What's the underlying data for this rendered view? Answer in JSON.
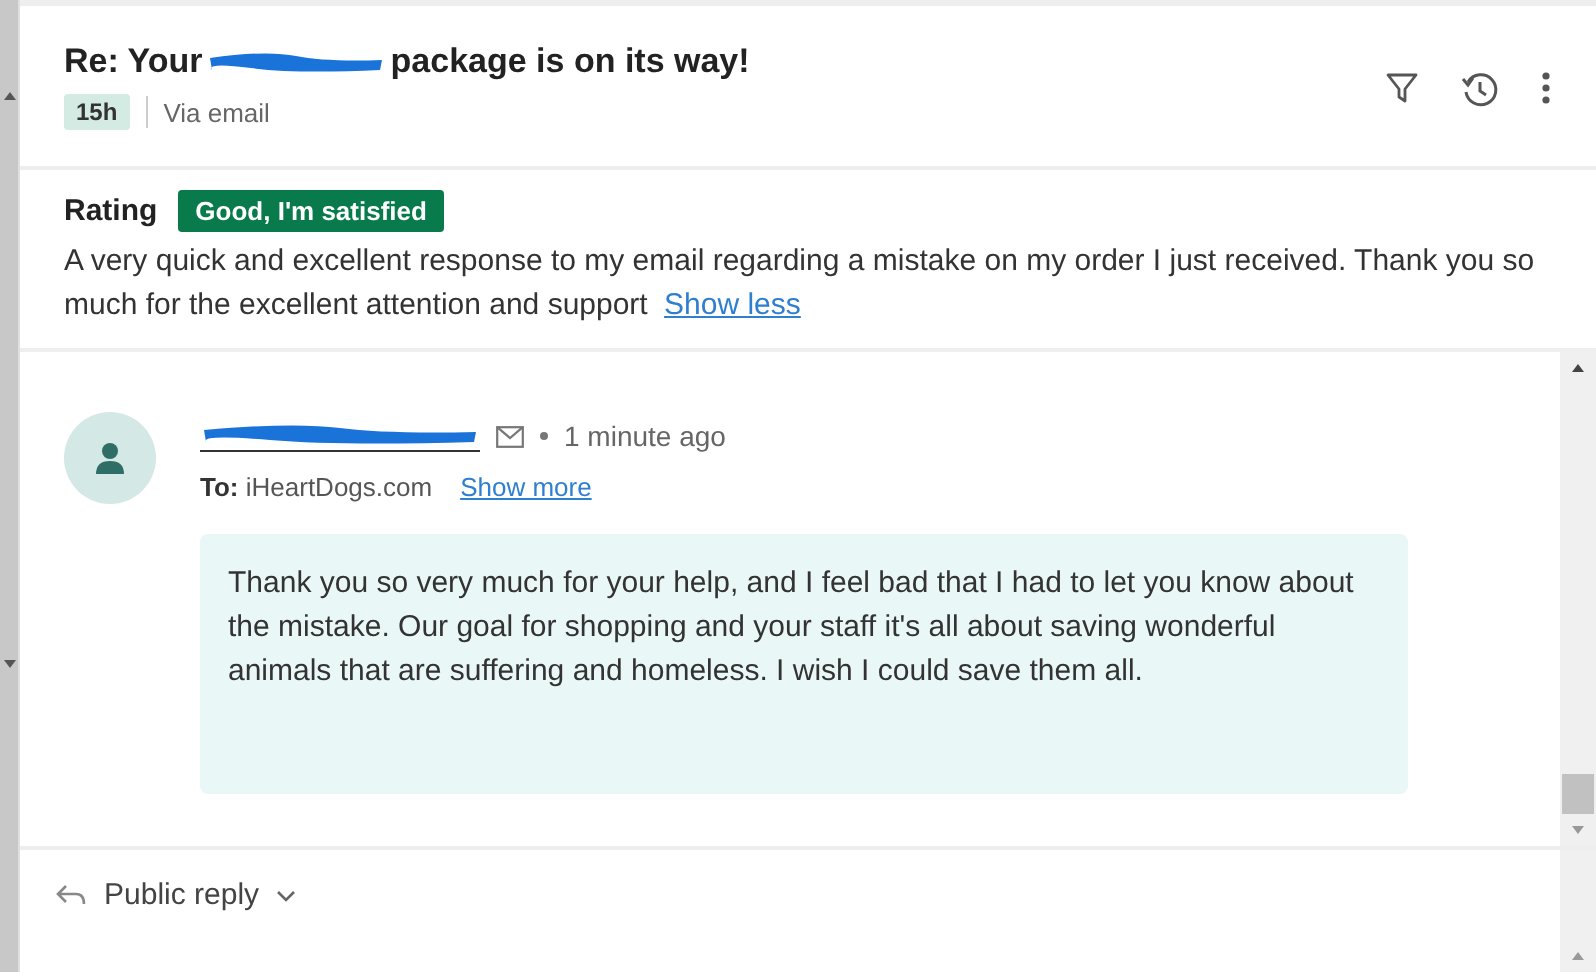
{
  "ticket": {
    "title_start": "Re: Your",
    "title_end": "package is on its way!",
    "age": "15h",
    "channel": "Via email"
  },
  "rating": {
    "label": "Rating",
    "value": "Good, I'm satisfied",
    "comment": "A very quick and excellent response to my email regarding a mistake on my order I just received. Thank you so much for the excellent attention and support",
    "toggle": "Show less"
  },
  "message": {
    "time": "1 minute ago",
    "to_label": "To:",
    "to": "iHeartDogs.com",
    "show_more": "Show more",
    "body": "Thank you so very much for your help, and I feel bad that I had to let you know about the mistake. Our goal for shopping and your staff it's all about saving wonderful animals that are suffering and homeless. I wish I could save them all."
  },
  "reply": {
    "label": "Public reply"
  }
}
